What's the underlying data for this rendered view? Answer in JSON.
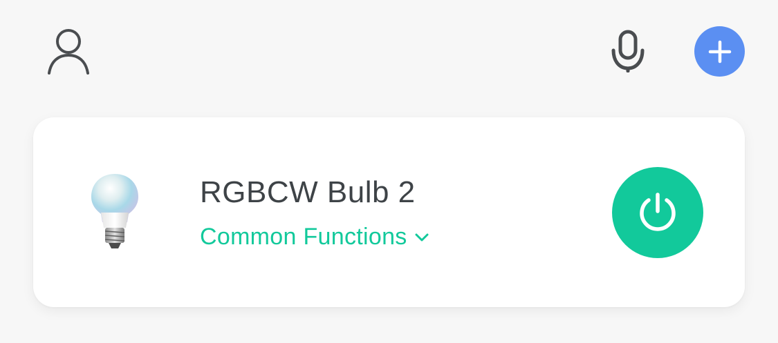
{
  "colors": {
    "background": "#f7f7f7",
    "card": "#ffffff",
    "accent_green": "#12c99b",
    "add_blue": "#5b8ff2",
    "icon_gray": "#4a4d50",
    "text_dark": "#3e4347"
  },
  "header": {
    "profile_icon": "person-outline-icon",
    "mic_icon": "microphone-icon",
    "add_icon": "plus-icon"
  },
  "device": {
    "name": "RGBCW Bulb 2",
    "functions_label": "Common Functions",
    "thumbnail_icon": "light-bulb-icon",
    "power_icon": "power-icon",
    "expand_icon": "chevron-down-icon"
  }
}
